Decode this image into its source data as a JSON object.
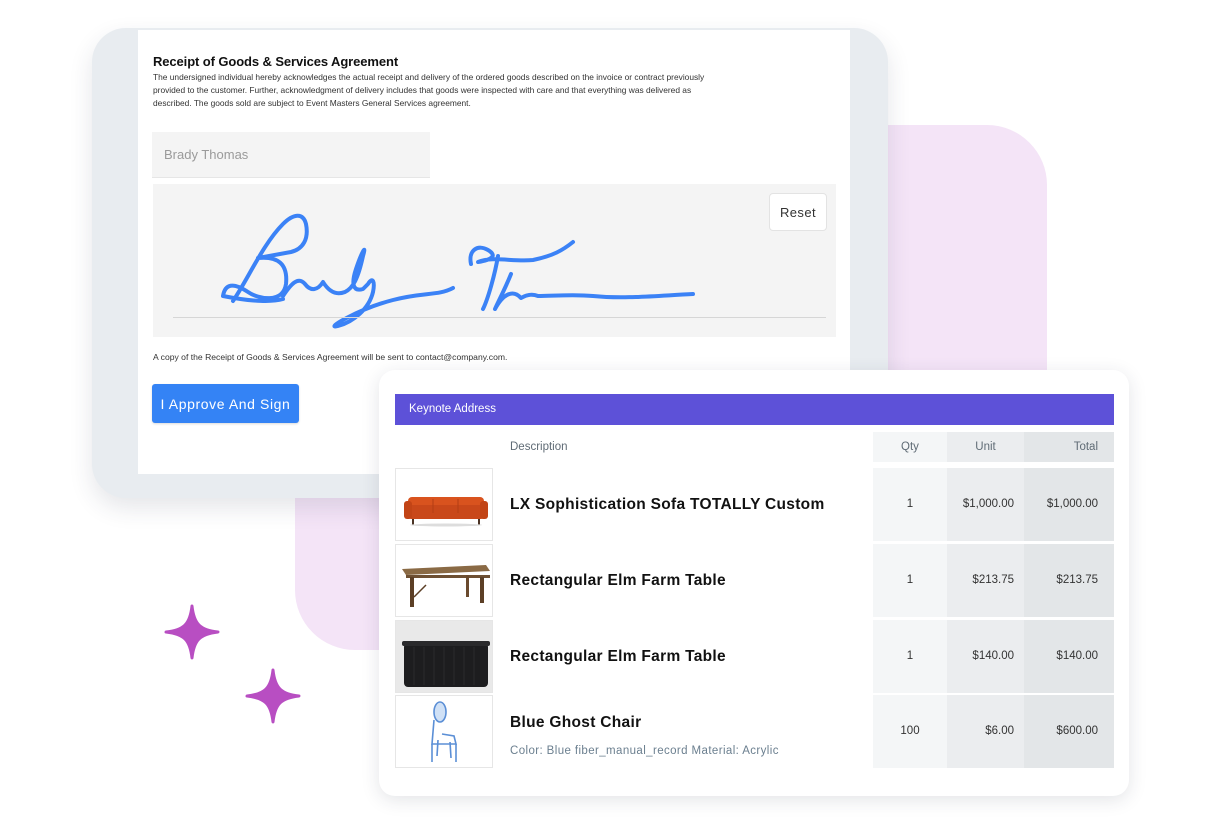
{
  "colors": {
    "accent_blue": "#3483f5",
    "header_purple": "#5d51d8",
    "sparkle": "#b84ec2",
    "pink_bg": "#f4e4f7",
    "signature_ink": "#3b82f6"
  },
  "agreement": {
    "title": "Receipt of Goods & Services Agreement",
    "body": "The undersigned individual hereby acknowledges the actual receipt and delivery of the ordered goods described on the invoice or contract previously provided to the customer. Further, acknowledgment of delivery includes that goods were inspected with care and that everything was delivered as described. The goods sold are subject to Event Masters General Services agreement.",
    "name_value": "Brady Thomas",
    "reset_label": "Reset",
    "copy_note": "A copy of the Receipt of Goods & Services Agreement will be sent to contact@company.com.",
    "approve_label": "I Approve And Sign"
  },
  "invoice": {
    "section_title": "Keynote Address",
    "columns": {
      "description": "Description",
      "qty": "Qty",
      "unit": "Unit",
      "total": "Total"
    },
    "items": [
      {
        "name": "LX Sophistication Sofa TOTALLY Custom",
        "meta": "",
        "qty": "1",
        "unit": "$1,000.00",
        "total": "$1,000.00",
        "image": "orange-sofa"
      },
      {
        "name": "Rectangular Elm Farm Table",
        "meta": "",
        "qty": "1",
        "unit": "$213.75",
        "total": "$213.75",
        "image": "wood-farm-table"
      },
      {
        "name": "Rectangular Elm Farm Table",
        "meta": "",
        "qty": "1",
        "unit": "$140.00",
        "total": "$140.00",
        "image": "black-fluted-table"
      },
      {
        "name": "Blue Ghost Chair",
        "meta": "Color: Blue fiber_manual_record Material: Acrylic",
        "qty": "100",
        "unit": "$6.00",
        "total": "$600.00",
        "image": "blue-ghost-chair"
      }
    ]
  }
}
